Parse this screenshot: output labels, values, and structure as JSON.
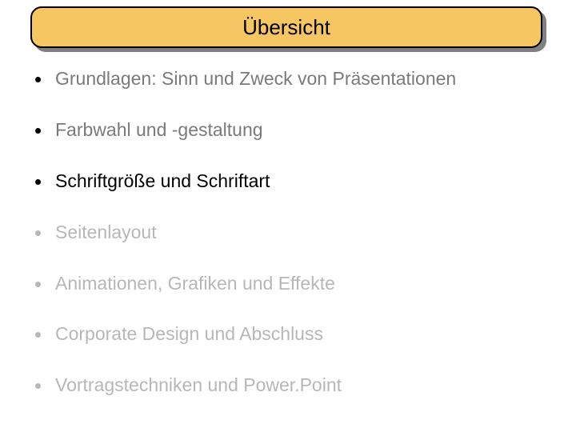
{
  "title": "Übersicht",
  "colors": {
    "title_bg": "#f5c661",
    "title_border": "#000000",
    "shadow": "#808080",
    "bullet_active": "#000000",
    "bullet_inactive": "#b7b7b7",
    "text_active": "#000000",
    "text_faded": "#b7b7b7",
    "text_semi": "#7a7a7a"
  },
  "bullets": [
    {
      "text": "Grundlagen: Sinn und Zweck von Präsentationen",
      "dot": "#000000",
      "color": "#7a7a7a"
    },
    {
      "text": "Farbwahl und -gestaltung",
      "dot": "#000000",
      "color": "#7a7a7a"
    },
    {
      "text": "Schriftgröße und Schriftart",
      "dot": "#000000",
      "color": "#000000"
    },
    {
      "text": "Seitenlayout",
      "dot": "#b7b7b7",
      "color": "#b7b7b7"
    },
    {
      "text": "Animationen, Grafiken und Effekte",
      "dot": "#b7b7b7",
      "color": "#b7b7b7"
    },
    {
      "text": "Corporate Design und Abschluss",
      "dot": "#b7b7b7",
      "color": "#b7b7b7"
    },
    {
      "text": "Vortragstechniken und Power.Point",
      "dot": "#b7b7b7",
      "color": "#b7b7b7"
    }
  ]
}
